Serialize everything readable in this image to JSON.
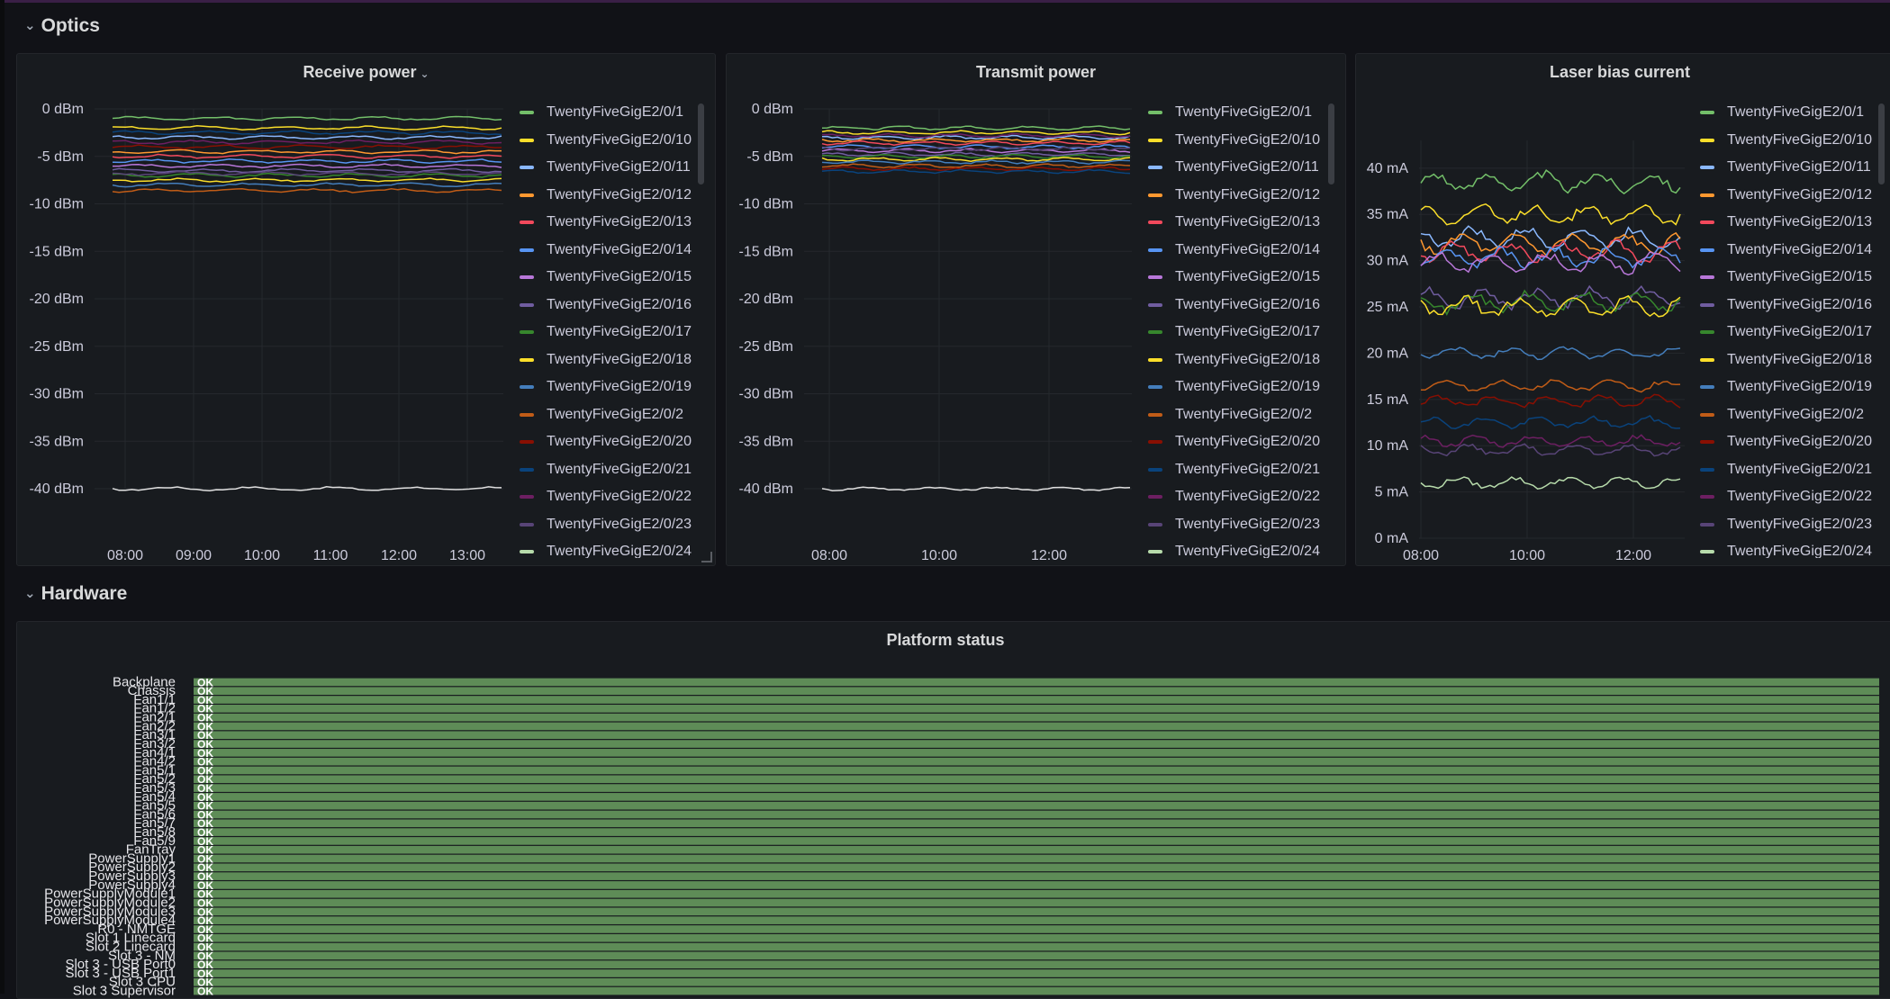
{
  "colors": {
    "background": "#111217",
    "panel": "#181b1f",
    "grid": "#2a2d33",
    "status_ok": "#5e8c57",
    "status_text": "#ffffff"
  },
  "rows": {
    "optics": {
      "title": "Optics"
    },
    "hardware": {
      "title": "Hardware"
    }
  },
  "legend_entries": [
    {
      "label": "TwentyFiveGigE2/0/1",
      "color": "#73bf69"
    },
    {
      "label": "TwentyFiveGigE2/0/10",
      "color": "#fade2a"
    },
    {
      "label": "TwentyFiveGigE2/0/11",
      "color": "#8ab8ff"
    },
    {
      "label": "TwentyFiveGigE2/0/12",
      "color": "#ff9830"
    },
    {
      "label": "TwentyFiveGigE2/0/13",
      "color": "#f2495c"
    },
    {
      "label": "TwentyFiveGigE2/0/14",
      "color": "#5794f2"
    },
    {
      "label": "TwentyFiveGigE2/0/15",
      "color": "#b877d9"
    },
    {
      "label": "TwentyFiveGigE2/0/16",
      "color": "#705da0"
    },
    {
      "label": "TwentyFiveGigE2/0/17",
      "color": "#37872d"
    },
    {
      "label": "TwentyFiveGigE2/0/18",
      "color": "#fade2a"
    },
    {
      "label": "TwentyFiveGigE2/0/19",
      "color": "#447ebc"
    },
    {
      "label": "TwentyFiveGigE2/0/2",
      "color": "#c15c17"
    },
    {
      "label": "TwentyFiveGigE2/0/20",
      "color": "#890f02"
    },
    {
      "label": "TwentyFiveGigE2/0/21",
      "color": "#0a437c"
    },
    {
      "label": "TwentyFiveGigE2/0/22",
      "color": "#6d1f62"
    },
    {
      "label": "TwentyFiveGigE2/0/23",
      "color": "#584477"
    },
    {
      "label": "TwentyFiveGigE2/0/24",
      "color": "#b7dbab"
    }
  ],
  "panels": {
    "receive_power": {
      "title": "Receive power"
    },
    "transmit_power": {
      "title": "Transmit power"
    },
    "laser_bias": {
      "title": "Laser bias current"
    },
    "platform_status": {
      "title": "Platform status"
    }
  },
  "chart_data": [
    {
      "type": "line",
      "title": "Receive power",
      "unit": "dBm",
      "x_ticks": [
        "08:00",
        "09:00",
        "10:00",
        "11:00",
        "12:00",
        "13:00"
      ],
      "y_ticks": [
        "0 dBm",
        "-5 dBm",
        "-10 dBm",
        "-15 dBm",
        "-20 dBm",
        "-25 dBm",
        "-30 dBm",
        "-35 dBm",
        "-40 dBm"
      ],
      "ylim": [
        -40,
        0
      ],
      "grid": true,
      "legend_placement": "right",
      "series_levels": [
        -1.0,
        -2.0,
        -3.0,
        -4.5,
        -5.0,
        -5.5,
        -6.0,
        -6.5,
        -7.0,
        -7.5,
        -8.0,
        -8.6,
        -4.0,
        -2.5,
        -3.5,
        -6.8,
        -40.0
      ]
    },
    {
      "type": "line",
      "title": "Transmit power",
      "unit": "dBm",
      "x_ticks": [
        "08:00",
        "10:00",
        "12:00"
      ],
      "y_ticks": [
        "0 dBm",
        "-5 dBm",
        "-10 dBm",
        "-15 dBm",
        "-20 dBm",
        "-25 dBm",
        "-30 dBm",
        "-35 dBm",
        "-40 dBm"
      ],
      "ylim": [
        -40,
        0
      ],
      "grid": true,
      "legend_placement": "right",
      "series_levels": [
        -2.0,
        -2.5,
        -3.0,
        -3.3,
        -3.6,
        -4.0,
        -4.4,
        -4.8,
        -5.0,
        -5.3,
        -5.6,
        -6.0,
        -6.3,
        -6.6,
        -2.8,
        -4.2,
        -40.0
      ]
    },
    {
      "type": "line",
      "title": "Laser bias current",
      "unit": "mA",
      "x_ticks": [
        "08:00",
        "10:00",
        "12:00"
      ],
      "y_ticks": [
        "40 mA",
        "35 mA",
        "30 mA",
        "25 mA",
        "20 mA",
        "15 mA",
        "10 mA",
        "5 mA",
        "0 mA"
      ],
      "ylim": [
        0,
        43
      ],
      "grid": true,
      "legend_placement": "right",
      "series_levels": [
        38.5,
        35.0,
        32.5,
        31.8,
        31.0,
        30.3,
        29.8,
        26.0,
        25.5,
        25.0,
        20.0,
        16.5,
        14.8,
        12.5,
        10.5,
        9.5,
        6.0
      ]
    },
    {
      "type": "table",
      "title": "Platform status",
      "value_label": "OK",
      "rows": [
        "Backplane",
        "Chassis",
        "Fan1/1",
        "Fan1/2",
        "Fan2/1",
        "Fan2/2",
        "Fan3/1",
        "Fan3/2",
        "Fan4/1",
        "Fan4/2",
        "Fan5/1",
        "Fan5/2",
        "Fan5/3",
        "Fan5/4",
        "Fan5/5",
        "Fan5/6",
        "Fan5/7",
        "Fan5/8",
        "Fan5/9",
        "FanTray",
        "PowerSupply1",
        "PowerSupply2",
        "PowerSupply3",
        "PowerSupply4",
        "PowerSupplyModule1",
        "PowerSupplyModule2",
        "PowerSupplyModule3",
        "PowerSupplyModule4",
        "R0 - NMTGE",
        "Slot 1 Linecard",
        "Slot 2 Linecard",
        "Slot 3 - NM",
        "Slot 3 - USB Port0",
        "Slot 3 - USB Port1",
        "Slot 3 CPU",
        "Slot 3 Supervisor"
      ]
    }
  ]
}
